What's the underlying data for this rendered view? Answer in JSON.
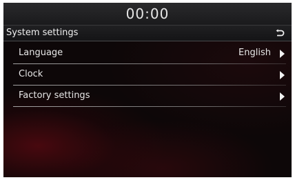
{
  "status_bar": {
    "time": "00:00"
  },
  "header": {
    "title": "System settings",
    "back_icon": "back-return-icon"
  },
  "menu": {
    "items": [
      {
        "label": "Language",
        "value": "English",
        "icon": "chevron-right-icon"
      },
      {
        "label": "Clock",
        "value": "",
        "icon": "chevron-right-icon"
      },
      {
        "label": "Factory settings",
        "value": "",
        "icon": "chevron-right-icon"
      }
    ]
  },
  "colors": {
    "text": "#e8e8e8",
    "background": "#0d0708",
    "accent_glow": "#780a14"
  }
}
